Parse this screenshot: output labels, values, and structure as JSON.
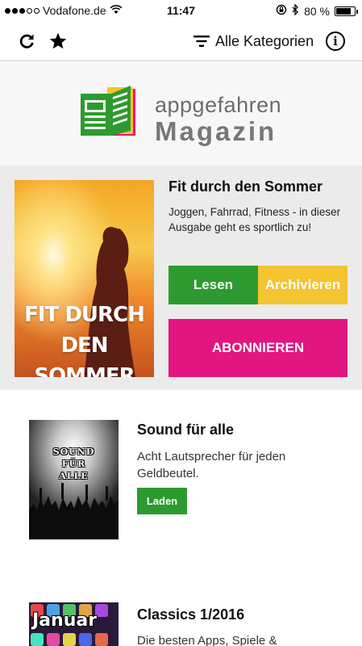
{
  "status_bar": {
    "carrier": "Vodafone.de",
    "time": "11:47",
    "battery_percent": "80 %",
    "battery_level": 0.8
  },
  "nav": {
    "categories_label": "Alle Kategorien",
    "icons": [
      "refresh-icon",
      "star-icon",
      "filter-icon",
      "info-icon"
    ]
  },
  "logo": {
    "top": "appgefahren",
    "bottom": "Magazin"
  },
  "featured": {
    "title": "Fit durch den Sommer",
    "description": "Joggen, Fahrrad, Fitness - in dieser Ausgabe geht es sportlich zu!",
    "cover_text_lines": [
      "FIT DURCH",
      "DEN",
      "SOMMER"
    ],
    "read_label": "Lesen",
    "archive_label": "Archivieren",
    "subscribe_label": "ABONNIEREN"
  },
  "issues": [
    {
      "title": "Sound für alle",
      "description": "Acht Lautsprecher für jeden Geldbeutel.",
      "cover_text_lines": [
        "SOUND",
        "FÜR",
        "ALLE"
      ],
      "load_label": "Laden"
    },
    {
      "title": "Classics 1/2016",
      "description": "Die besten Apps, Spiele &",
      "cover_text": "Januar"
    }
  ],
  "colors": {
    "green": "#2d9a2f",
    "yellow": "#f4c431",
    "magenta": "#e3157e",
    "featured_bg": "#ebebeb"
  }
}
